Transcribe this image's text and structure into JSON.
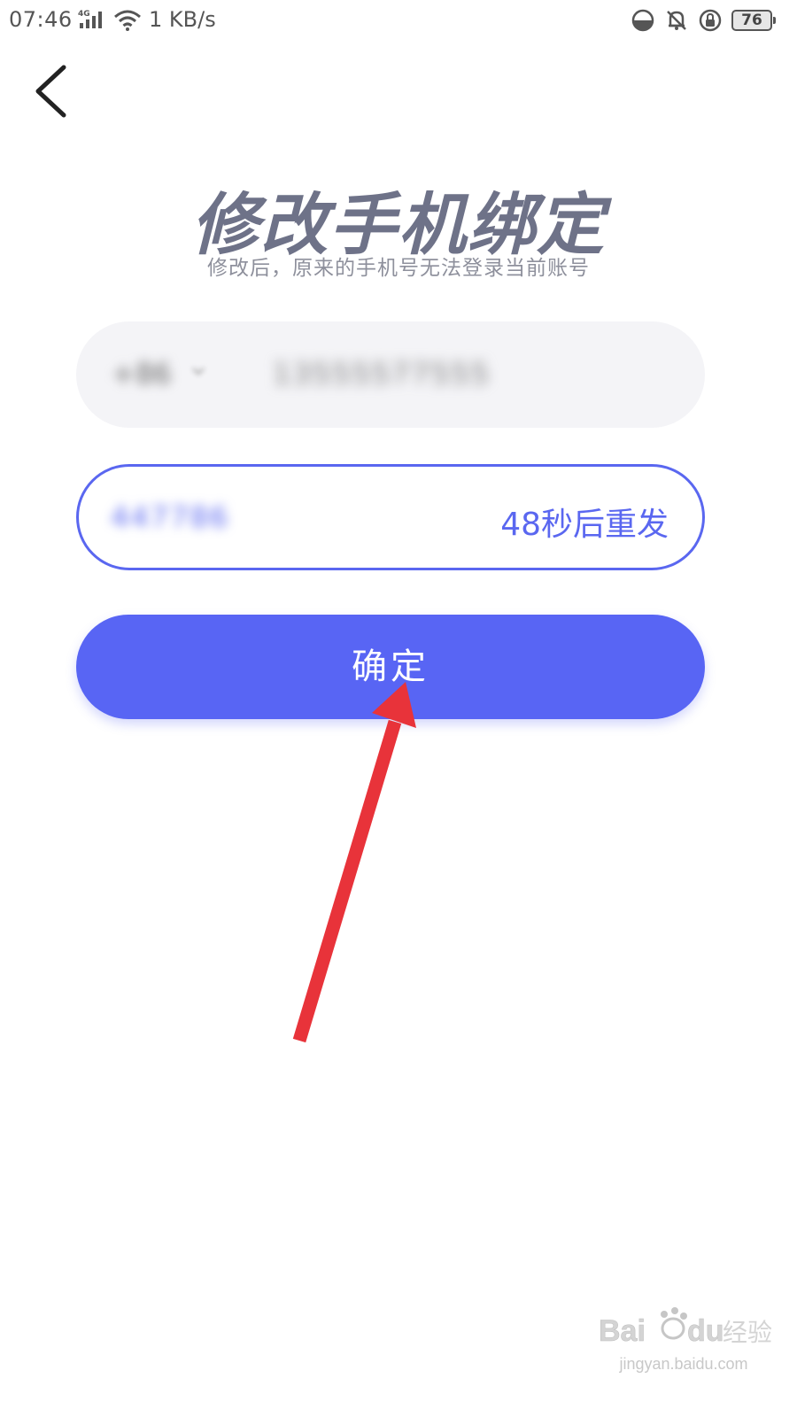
{
  "status_bar": {
    "time": "07:46",
    "network_type": "4G",
    "speed": "1 KB/s",
    "battery_level": "76"
  },
  "header": {
    "title": "修改手机绑定",
    "subtitle": "修改后，原来的手机号无法登录当前账号"
  },
  "phone_field": {
    "country_code": "+86",
    "phone_number": "13555577555"
  },
  "code_field": {
    "code_value": "447786",
    "resend_label": "48秒后重发"
  },
  "confirm_button": {
    "label": "确定"
  },
  "colors": {
    "accent": "#5865f4",
    "title": "#6e7288",
    "field_bg": "#f4f4f7",
    "arrow": "#e8333a"
  },
  "watermark": {
    "brand": "Baidu经验",
    "url": "jingyan.baidu.com"
  },
  "icons": {
    "back": "chevron-left-icon",
    "signal": "signal-icon",
    "wifi": "wifi-icon",
    "night": "night-mode-icon",
    "mute": "bell-muted-icon",
    "lock": "rotation-lock-icon",
    "battery": "battery-icon"
  }
}
